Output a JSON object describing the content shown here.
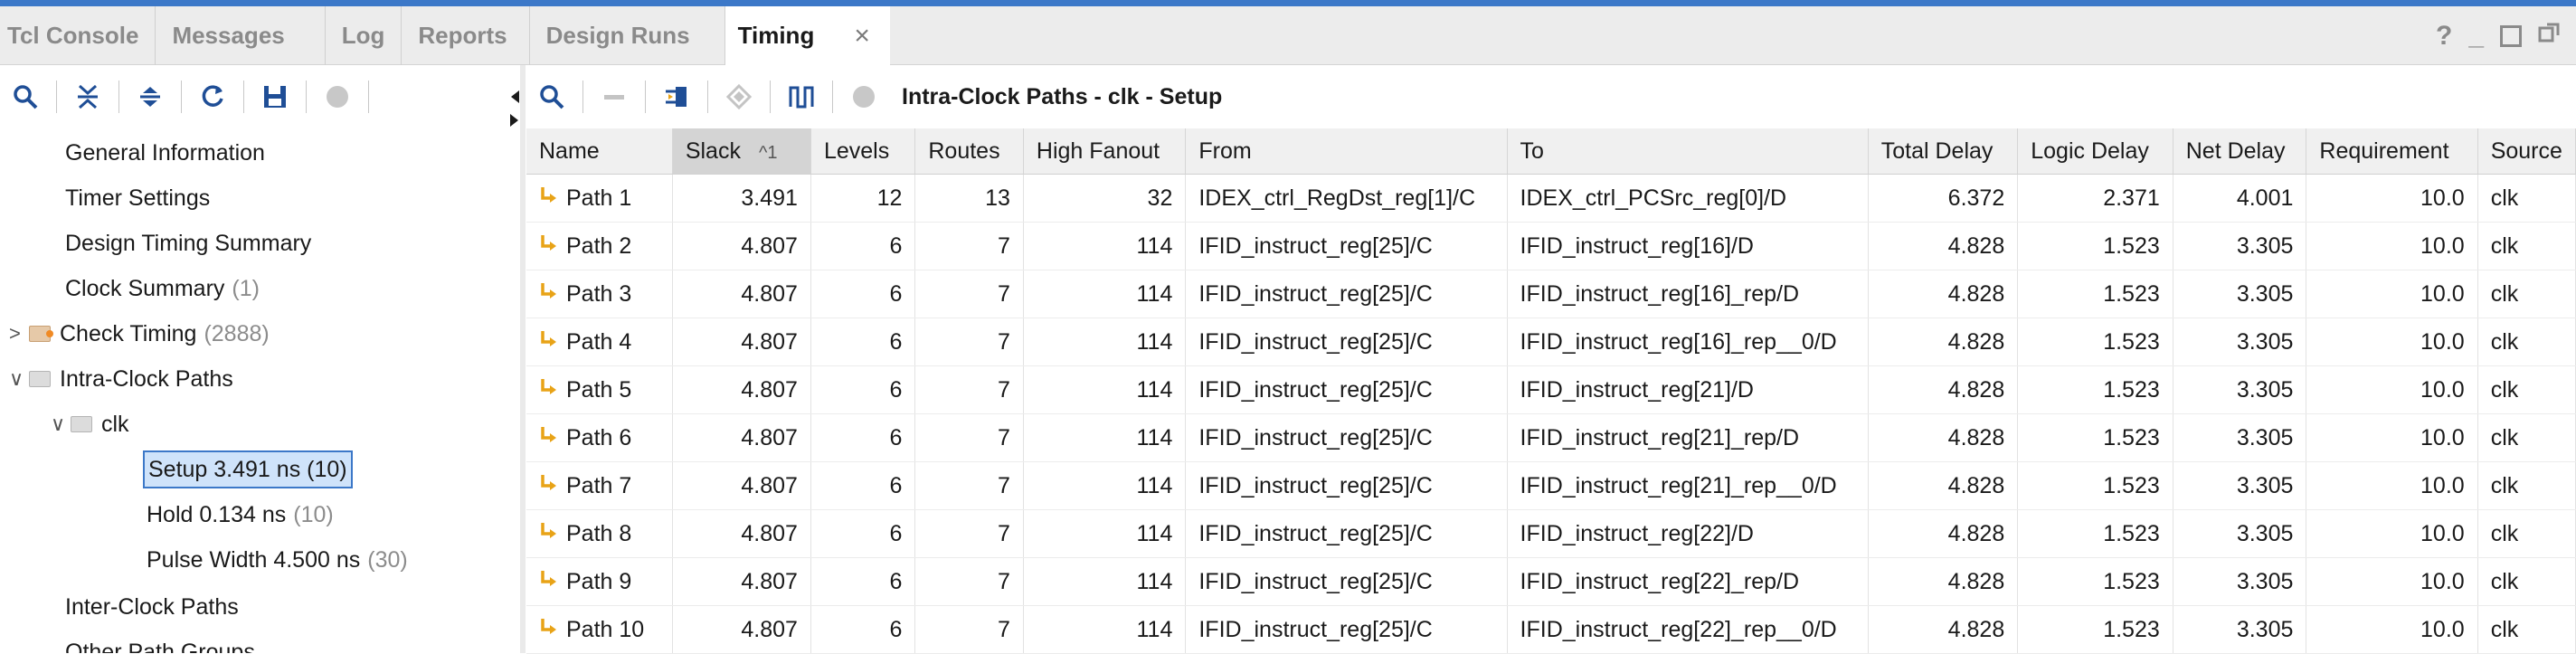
{
  "tabs": [
    {
      "label": "Tcl Console"
    },
    {
      "label": "Messages"
    },
    {
      "label": "Log"
    },
    {
      "label": "Reports"
    },
    {
      "label": "Design Runs"
    },
    {
      "label": "Timing",
      "close": "×"
    }
  ],
  "window_controls": {
    "help": "?",
    "minimize": "_"
  },
  "tree": {
    "items": [
      {
        "label": "General Information"
      },
      {
        "label": "Timer Settings"
      },
      {
        "label": "Design Timing Summary"
      },
      {
        "label": "Clock Summary",
        "count": "(1)"
      },
      {
        "label": "Check Timing",
        "count": "(2888)",
        "expander": ">"
      },
      {
        "label": "Intra-Clock Paths",
        "expander": "∨"
      },
      {
        "label": "clk",
        "expander": "∨"
      },
      {
        "label": "Setup 3.491 ns (10)"
      },
      {
        "label": "Hold 0.134 ns",
        "count": "(10)"
      },
      {
        "label": "Pulse Width 4.500 ns",
        "count": "(30)"
      },
      {
        "label": "Inter-Clock Paths"
      },
      {
        "label": "Other Path Groups"
      }
    ]
  },
  "panel": {
    "title": "Intra-Clock Paths - clk - Setup"
  },
  "table": {
    "columns": [
      "Name",
      "Slack",
      "Levels",
      "Routes",
      "High Fanout",
      "From",
      "To",
      "Total Delay",
      "Logic Delay",
      "Net Delay",
      "Requirement",
      "Source"
    ],
    "sort_indicator": "^1",
    "rows": [
      [
        "Path 1",
        "3.491",
        "12",
        "13",
        "32",
        "IDEX_ctrl_RegDst_reg[1]/C",
        "IDEX_ctrl_PCSrc_reg[0]/D",
        "6.372",
        "2.371",
        "4.001",
        "10.0",
        "clk"
      ],
      [
        "Path 2",
        "4.807",
        "6",
        "7",
        "114",
        "IFID_instruct_reg[25]/C",
        "IFID_instruct_reg[16]/D",
        "4.828",
        "1.523",
        "3.305",
        "10.0",
        "clk"
      ],
      [
        "Path 3",
        "4.807",
        "6",
        "7",
        "114",
        "IFID_instruct_reg[25]/C",
        "IFID_instruct_reg[16]_rep/D",
        "4.828",
        "1.523",
        "3.305",
        "10.0",
        "clk"
      ],
      [
        "Path 4",
        "4.807",
        "6",
        "7",
        "114",
        "IFID_instruct_reg[25]/C",
        "IFID_instruct_reg[16]_rep__0/D",
        "4.828",
        "1.523",
        "3.305",
        "10.0",
        "clk"
      ],
      [
        "Path 5",
        "4.807",
        "6",
        "7",
        "114",
        "IFID_instruct_reg[25]/C",
        "IFID_instruct_reg[21]/D",
        "4.828",
        "1.523",
        "3.305",
        "10.0",
        "clk"
      ],
      [
        "Path 6",
        "4.807",
        "6",
        "7",
        "114",
        "IFID_instruct_reg[25]/C",
        "IFID_instruct_reg[21]_rep/D",
        "4.828",
        "1.523",
        "3.305",
        "10.0",
        "clk"
      ],
      [
        "Path 7",
        "4.807",
        "6",
        "7",
        "114",
        "IFID_instruct_reg[25]/C",
        "IFID_instruct_reg[21]_rep__0/D",
        "4.828",
        "1.523",
        "3.305",
        "10.0",
        "clk"
      ],
      [
        "Path 8",
        "4.807",
        "6",
        "7",
        "114",
        "IFID_instruct_reg[25]/C",
        "IFID_instruct_reg[22]/D",
        "4.828",
        "1.523",
        "3.305",
        "10.0",
        "clk"
      ],
      [
        "Path 9",
        "4.807",
        "6",
        "7",
        "114",
        "IFID_instruct_reg[25]/C",
        "IFID_instruct_reg[22]_rep/D",
        "4.828",
        "1.523",
        "3.305",
        "10.0",
        "clk"
      ],
      [
        "Path 10",
        "4.807",
        "6",
        "7",
        "114",
        "IFID_instruct_reg[25]/C",
        "IFID_instruct_reg[22]_rep__0/D",
        "4.828",
        "1.523",
        "3.305",
        "10.0",
        "clk"
      ]
    ]
  },
  "colors": {
    "accent": "#3c78c8",
    "icon_blue": "#1f4e96",
    "path_icon": "#e8a317",
    "selection": "#cfe3fa"
  }
}
